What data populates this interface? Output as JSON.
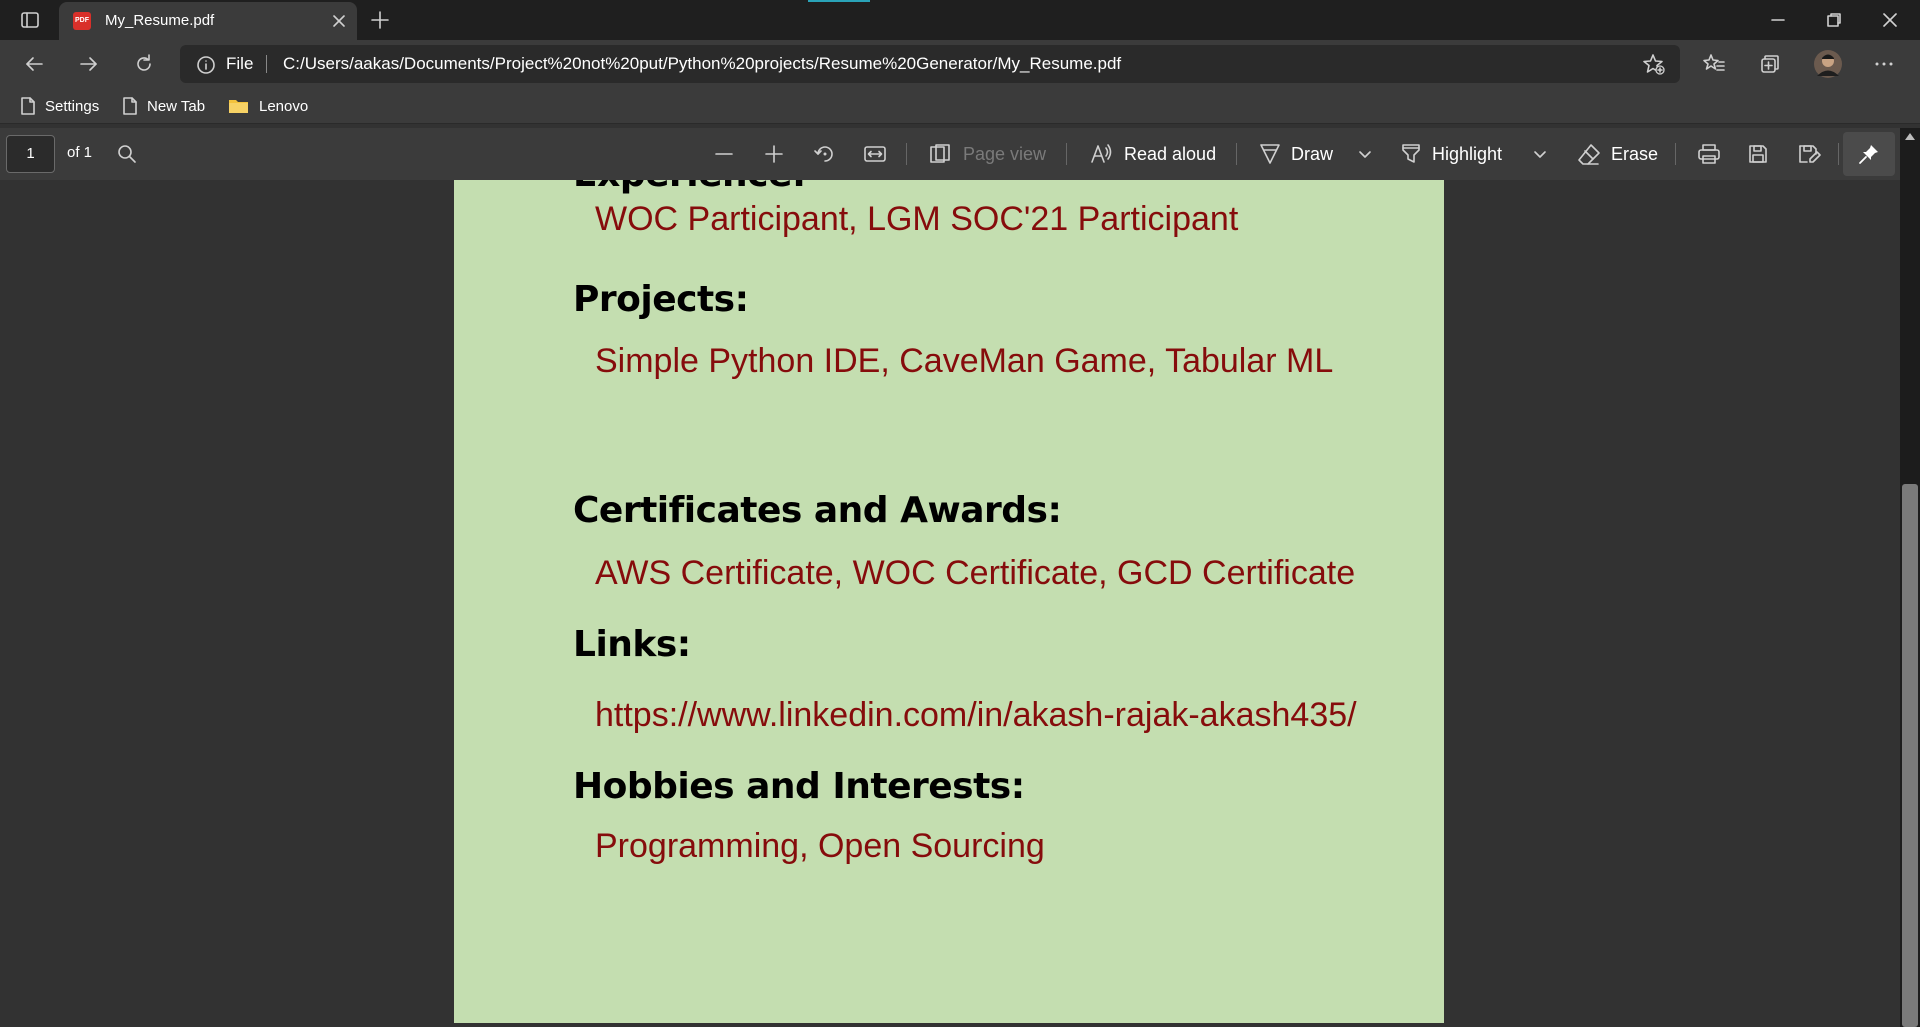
{
  "browser": {
    "tab_title": "My_Resume.pdf",
    "tab_favicon_text": "PDF",
    "url_scheme": "File",
    "url": "C:/Users/aakas/Documents/Project%20not%20put/Python%20projects/Resume%20Generator/My_Resume.pdf"
  },
  "favorites": [
    {
      "label": "Settings",
      "icon": "page-icon"
    },
    {
      "label": "New Tab",
      "icon": "page-icon"
    },
    {
      "label": "Lenovo",
      "icon": "folder-icon"
    }
  ],
  "pdf_toolbar": {
    "page_number": "1",
    "page_of": "of 1",
    "page_view_label": "Page view",
    "read_aloud_label": "Read aloud",
    "draw_label": "Draw",
    "highlight_label": "Highlight",
    "erase_label": "Erase"
  },
  "document": {
    "cut_heading": "Experience:",
    "experience": "WOC Participant, LGM SOC'21 Participant",
    "projects_heading": "Projects:",
    "projects": "Simple Python IDE, CaveMan Game, Tabular ML",
    "certs_heading": "Certificates and Awards:",
    "certs": "AWS Certificate, WOC Certificate, GCD Certificate",
    "links_heading": "Links:",
    "links": "https://www.linkedin.com/in/akash-rajak-akash435/",
    "hobbies_heading": "Hobbies and Interests:",
    "hobbies": "Programming, Open Sourcing"
  },
  "colors": {
    "page_background": "#c4deb0",
    "value_text": "#860c0c",
    "heading_text": "#000000"
  }
}
